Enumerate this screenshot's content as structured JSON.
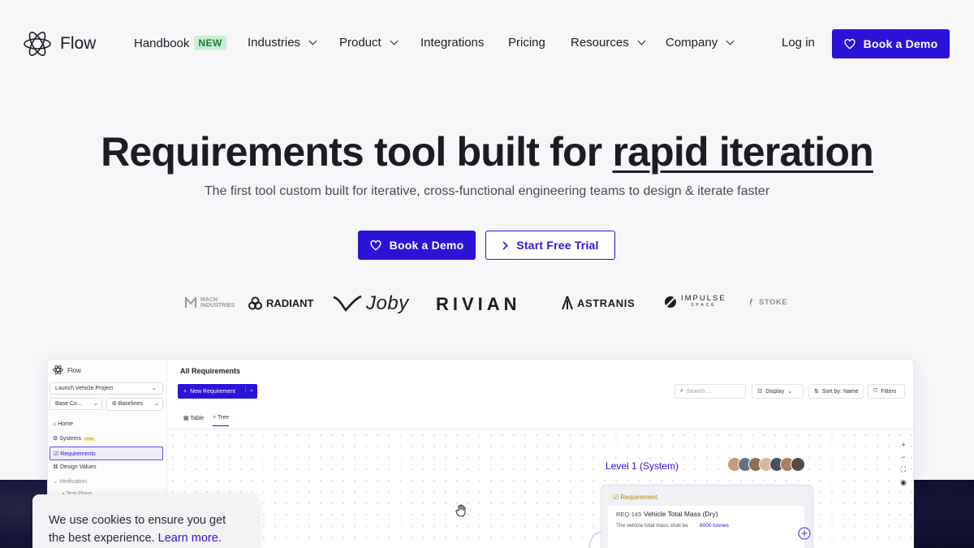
{
  "nav": {
    "logo_text": "Flow",
    "items": [
      {
        "label": "Handbook",
        "badge": "NEW"
      },
      {
        "label": "Industries"
      },
      {
        "label": "Product"
      },
      {
        "label": "Integrations"
      },
      {
        "label": "Pricing"
      },
      {
        "label": "Resources"
      },
      {
        "label": "Company"
      }
    ],
    "login": "Log in",
    "cta": "Book a Demo"
  },
  "hero": {
    "title_plain": "Requirements tool built for ",
    "title_emph": "rapid iteration",
    "subtitle": "The first tool custom built for iterative, cross-functional engineering teams to design & iterate faster",
    "cta_primary": "Book a Demo",
    "cta_secondary": "Start Free Trial"
  },
  "logos": {
    "mach": "MACH INDUSTRIES",
    "radiant": "RADIANT",
    "joby": "Joby",
    "rivian": "RIVIAN",
    "astranis": "ASTRANIS",
    "impulse": "IMPULSE",
    "impulse_sub": "SPACE",
    "stoke": "STOKE"
  },
  "app": {
    "brand": "Flow",
    "project": "Launch Vehicle Project",
    "base": "Base Co...",
    "baselines": "Baselines",
    "sidebar": [
      "Home",
      "Systems",
      "Requirements",
      "Design Values",
      "Verification",
      "Test Plans"
    ],
    "systems_badge": "beta",
    "page_title": "All Requirements",
    "new_requirement": "New Requirement",
    "search_placeholder": "Search ...",
    "display": "Display",
    "sort": "Sort by: Name",
    "filters": "Filters",
    "tabs": [
      "Table",
      "Tree"
    ],
    "level_title": "Level 1 (System)",
    "card_tag": "Requirement",
    "card_id": "REQ-145",
    "card_title": "Vehicle Total Mass (Dry)",
    "card_text": "The vehicle total mass shall be",
    "card_value": "6000 tonnes"
  },
  "cookie": {
    "text": "We use cookies to ensure you get the best experience.",
    "link": "Learn more."
  },
  "colors": {
    "accent": "#2b14d8",
    "badge_bg": "#c9f0d4",
    "badge_fg": "#1e7a3c"
  }
}
